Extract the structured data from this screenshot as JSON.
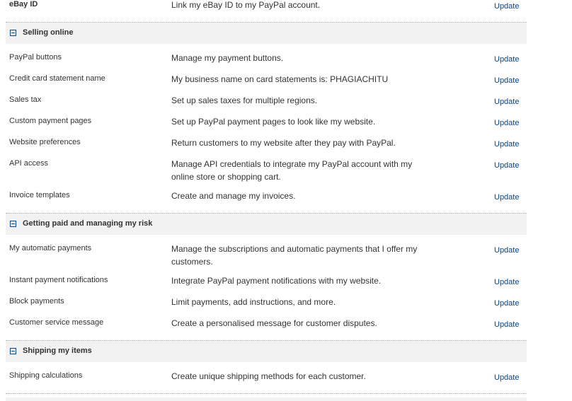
{
  "ebay": {
    "label": "eBay ID",
    "desc": "Link my eBay ID to my PayPal account.",
    "link": "Update"
  },
  "selling": {
    "title": "Selling online",
    "items": [
      {
        "label": "PayPal buttons",
        "desc": "Manage my payment buttons.",
        "link": "Update"
      },
      {
        "label": "Credit card statement name",
        "desc": "My business name on card statements is: PHAGIACHITU",
        "link": "Update"
      },
      {
        "label": "Sales tax",
        "desc": "Set up sales taxes for multiple regions.",
        "link": "Update"
      },
      {
        "label": "Custom payment pages",
        "desc": "Set up PayPal payment pages to look like my website.",
        "link": "Update"
      },
      {
        "label": "Website preferences",
        "desc": "Return customers to my website after they pay with PayPal.",
        "link": "Update"
      },
      {
        "label": "API access",
        "desc": "Manage API credentials to integrate my PayPal account with my online store or shopping cart.",
        "link": "Update"
      },
      {
        "label": "Invoice templates",
        "desc": "Create and manage my invoices.",
        "link": "Update"
      }
    ]
  },
  "risk": {
    "title": "Getting paid and managing my risk",
    "items": [
      {
        "label": "My automatic payments",
        "desc": "Manage the subscriptions and automatic payments that I offer my customers.",
        "link": "Update"
      },
      {
        "label": "Instant payment notifications",
        "desc": "Integrate PayPal payment notifications with my website.",
        "link": "Update"
      },
      {
        "label": "Block payments",
        "desc": "Limit payments, add instructions, and more.",
        "link": "Update"
      },
      {
        "label": "Customer service message",
        "desc": "Create a personalised message for customer disputes.",
        "link": "Update"
      }
    ]
  },
  "shipping": {
    "title": "Shipping my items",
    "items": [
      {
        "label": "Shipping calculations",
        "desc": "Create unique shipping methods for each customer.",
        "link": "Update"
      }
    ]
  }
}
